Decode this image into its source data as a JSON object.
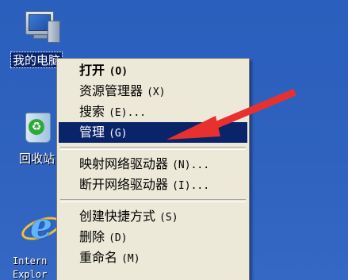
{
  "desktop": {
    "icons": [
      {
        "label": "我的电脑",
        "icon": "my-computer-icon"
      },
      {
        "label": "回收站",
        "icon": "recycle-bin-icon"
      },
      {
        "label_line1": "Intern",
        "label_line2": "Explor",
        "icon": "internet-explorer-icon"
      }
    ],
    "background": "#2f62bf",
    "selection_color": "#0a246a"
  },
  "context_menu": {
    "items": [
      {
        "label": "打开",
        "accel": "(O)",
        "bold": true
      },
      {
        "label": "资源管理器",
        "accel": "(X)"
      },
      {
        "label": "搜索",
        "accel": "(E)..."
      },
      {
        "label": "管理",
        "accel": "(G)",
        "highlighted": true
      },
      {
        "label": "映射网络驱动器",
        "accel": "(N)..."
      },
      {
        "label": "断开网络驱动器",
        "accel": "(I)..."
      },
      {
        "label": "创建快捷方式",
        "accel": "(S)"
      },
      {
        "label": "删除",
        "accel": "(D)"
      },
      {
        "label": "重命名",
        "accel": "(M)"
      }
    ],
    "highlight_color": "#0a246a",
    "background": "#ece9d8"
  },
  "annotation": {
    "icon": "red-arrow-icon",
    "color": "#e8312f"
  }
}
